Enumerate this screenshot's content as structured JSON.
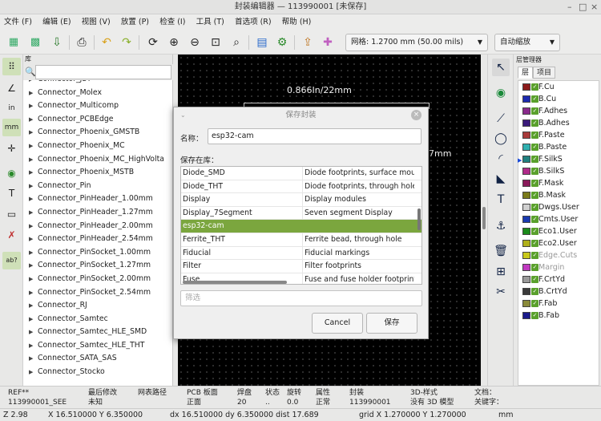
{
  "window": {
    "title": "封装编辑器 — 113990001 [未保存]",
    "controls": [
      "–",
      "□",
      "×"
    ]
  },
  "menu": [
    "文件 (F)",
    "编辑 (E)",
    "视图 (V)",
    "放置 (P)",
    "检查 (I)",
    "工具 (T)",
    "首选项 (R)",
    "帮助 (H)"
  ],
  "toolbar": {
    "grid": "网格: 1.2700 mm (50.00 mils)",
    "zoom": "自动缩放"
  },
  "library": {
    "header": "库",
    "items": [
      "Connector_JST",
      "Connector_Molex",
      "Connector_Multicomp",
      "Connector_PCBEdge",
      "Connector_Phoenix_GMSTB",
      "Connector_Phoenix_MC",
      "Connector_Phoenix_MC_HighVolta",
      "Connector_Phoenix_MSTB",
      "Connector_Pin",
      "Connector_PinHeader_1.00mm",
      "Connector_PinHeader_1.27mm",
      "Connector_PinHeader_2.00mm",
      "Connector_PinHeader_2.54mm",
      "Connector_PinSocket_1.00mm",
      "Connector_PinSocket_1.27mm",
      "Connector_PinSocket_2.00mm",
      "Connector_PinSocket_2.54mm",
      "Connector_RJ",
      "Connector_Samtec",
      "Connector_Samtec_HLE_SMD",
      "Connector_Samtec_HLE_THT",
      "Connector_SATA_SAS",
      "Connector_Stocko"
    ]
  },
  "canvas": {
    "dimension_top": "0.866In/22mm",
    "dimension_right": "7mm"
  },
  "dialog": {
    "title": "保存封装",
    "name_label": "名称：",
    "name_value": "esp32-cam",
    "save_in_label": "保存在库：",
    "rows": [
      {
        "name": "Diode_SMD",
        "desc": "Diode footprints, surface mount"
      },
      {
        "name": "Diode_THT",
        "desc": "Diode footprints, through hole"
      },
      {
        "name": "Display",
        "desc": "Display modules"
      },
      {
        "name": "Display_7Segment",
        "desc": "Seven segment Display"
      },
      {
        "name": "esp32-cam",
        "desc": ""
      },
      {
        "name": "Ferrite_THT",
        "desc": "Ferrite bead, through hole"
      },
      {
        "name": "Fiducial",
        "desc": "Fiducial markings"
      },
      {
        "name": "Filter",
        "desc": "Filter footprints"
      },
      {
        "name": "Fuse",
        "desc": "Fuse and fuse holder footprints"
      }
    ],
    "selected_index": 4,
    "filter_placeholder": "筛选",
    "cancel": "Cancel",
    "save": "保存"
  },
  "layers": {
    "header": "层管理器",
    "tabs": [
      "层",
      "项目"
    ],
    "items": [
      {
        "name": "F.Cu",
        "color": "#8b1a1a"
      },
      {
        "name": "B.Cu",
        "color": "#1c2bb0"
      },
      {
        "name": "F.Adhes",
        "color": "#8a2a8c"
      },
      {
        "name": "B.Adhes",
        "color": "#3a1a7a"
      },
      {
        "name": "F.Paste",
        "color": "#a83a3a"
      },
      {
        "name": "B.Paste",
        "color": "#30b0b0"
      },
      {
        "name": "F.SilkS",
        "color": "#208080"
      },
      {
        "name": "B.SilkS",
        "color": "#b02a8a"
      },
      {
        "name": "F.Mask",
        "color": "#8a1a5a"
      },
      {
        "name": "B.Mask",
        "color": "#7a7a1a"
      },
      {
        "name": "Dwgs.User",
        "color": "#d0d0d0"
      },
      {
        "name": "Cmts.User",
        "color": "#1a3ab0"
      },
      {
        "name": "Eco1.User",
        "color": "#1a8a1a"
      },
      {
        "name": "Eco2.User",
        "color": "#b0b01a"
      },
      {
        "name": "Edge.Cuts",
        "color": "#c8c81a"
      },
      {
        "name": "Margin",
        "color": "#c03ac0"
      },
      {
        "name": "F.CrtYd",
        "color": "#9a9a9a"
      },
      {
        "name": "B.CrtYd",
        "color": "#3a3a3a"
      },
      {
        "name": "F.Fab",
        "color": "#8a8a3a"
      },
      {
        "name": "B.Fab",
        "color": "#1a1a8a"
      }
    ],
    "selected": "F.SilkS"
  },
  "status": {
    "cells": [
      {
        "k": "REF**",
        "v": "113990001_SEE"
      },
      {
        "k": "最后修改",
        "v": "未知"
      },
      {
        "k": "网表路径",
        "v": ""
      },
      {
        "k": "PCB 板面",
        "v": "正面"
      },
      {
        "k": "焊盘",
        "v": "20"
      },
      {
        "k": "状态",
        "v": ".."
      },
      {
        "k": "旋转",
        "v": "0.0"
      },
      {
        "k": "属性",
        "v": "正常"
      },
      {
        "k": "封装",
        "v": "113990001"
      },
      {
        "k": "3D-样式",
        "v": "没有 3D 模型"
      },
      {
        "k": "文档：",
        "v": "关键字："
      }
    ],
    "zoom": "Z 2.98",
    "xy": "X 16.510000  Y 6.350000",
    "d": "dx 16.510000  dy 6.350000  dist 17.689",
    "grid": "grid X 1.270000  Y 1.270000",
    "units": "mm"
  }
}
